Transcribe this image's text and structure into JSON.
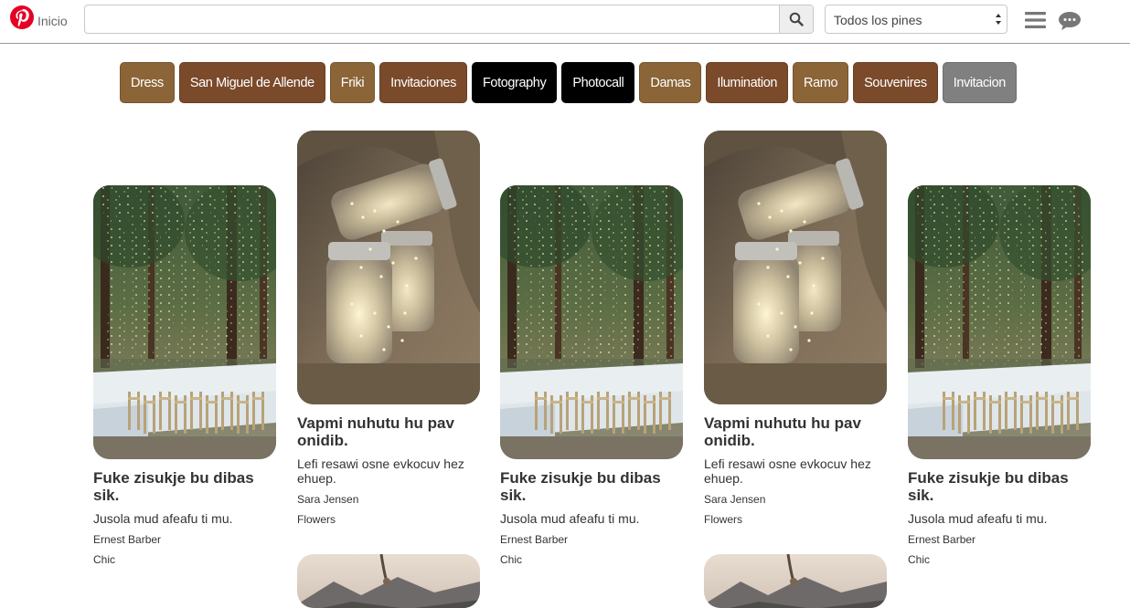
{
  "header": {
    "home_label": "Inicio",
    "search": {
      "value": "",
      "placeholder": ""
    },
    "filter": {
      "selected": "Todos los pines"
    },
    "icons": [
      "pinterest-logo-icon",
      "search-icon",
      "menu-icon",
      "chat-icon"
    ]
  },
  "tags": [
    {
      "label": "Dress",
      "color": "#8b6437"
    },
    {
      "label": "San Miguel de Allende",
      "color": "#7a4a2a"
    },
    {
      "label": "Friki",
      "color": "#8b6437"
    },
    {
      "label": "Invitaciones",
      "color": "#7a4a2a"
    },
    {
      "label": "Fotography",
      "color": "#000000"
    },
    {
      "label": "Photocall",
      "color": "#000000"
    },
    {
      "label": "Damas",
      "color": "#8b6437"
    },
    {
      "label": "Ilumination",
      "color": "#7a4a2a"
    },
    {
      "label": "Ramo",
      "color": "#8b6437"
    },
    {
      "label": "Souvenires",
      "color": "#7a4a2a"
    },
    {
      "label": "Invitacion",
      "color": "#808080"
    }
  ],
  "pins": [
    {
      "title": "Fuke zisukje bu dibas sik.",
      "description": "Jusola mud afeafu ti mu.",
      "author": "Ernest Barber",
      "board": "Chic",
      "image": "forest-wedding-table"
    },
    {
      "title": "Vapmi nuhutu hu pav onidib.",
      "description": "Lefi resawi osne evkocuv hez ehuep.",
      "author": "Sara Jensen",
      "board": "Flowers",
      "image": "fairy-light-jars"
    },
    {
      "title": "Fuke zisukje bu dibas sik.",
      "description": "Jusola mud afeafu ti mu.",
      "author": "Ernest Barber",
      "board": "Chic",
      "image": "forest-wedding-table"
    },
    {
      "title": "Vapmi nuhutu hu pav onidib.",
      "description": "Lefi resawi osne evkocuv hez ehuep.",
      "author": "Sara Jensen",
      "board": "Flowers",
      "image": "fairy-light-jars"
    },
    {
      "title": "Fuke zisukje bu dibas sik.",
      "description": "Jusola mud afeafu ti mu.",
      "author": "Ernest Barber",
      "board": "Chic",
      "image": "forest-wedding-table"
    }
  ],
  "more_pins": [
    {
      "image": "mountain-view"
    },
    {
      "image": "mountain-view"
    }
  ],
  "colors": {
    "brand": "#e60023",
    "header_border": "#9a9a9a"
  }
}
